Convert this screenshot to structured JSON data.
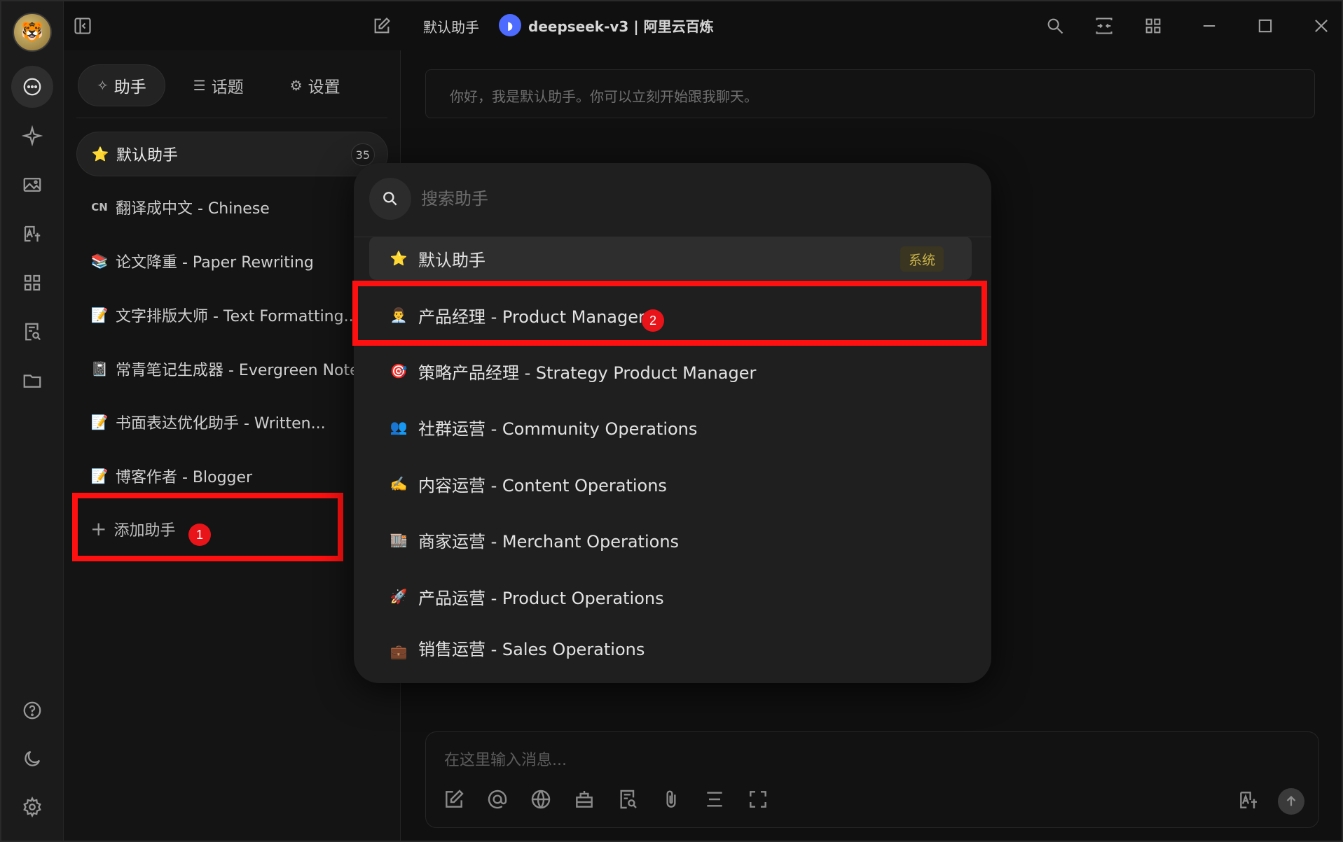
{
  "titlebar": {
    "assistant_title": "默认助手",
    "model_name": "deepseek-v3 | 阿里云百炼",
    "model_logo_icon": "deepseek-whale-icon"
  },
  "sidebar": {
    "tabs": [
      {
        "label": "助手",
        "icon": "sparkle-icon",
        "active": true
      },
      {
        "label": "话题",
        "icon": "list-icon",
        "active": false
      },
      {
        "label": "设置",
        "icon": "gear-icon",
        "active": false
      }
    ],
    "assistants": [
      {
        "emoji": "⭐",
        "label": "默认助手",
        "count": "35",
        "active": true
      },
      {
        "emoji": "CN",
        "label": "翻译成中文 - Chinese"
      },
      {
        "emoji": "📚",
        "label": "论文降重 - Paper Rewriting"
      },
      {
        "emoji": "📝",
        "label": "文字排版大师 - Text Formatting..."
      },
      {
        "emoji": "📓",
        "label": "常青笔记生成器 - Evergreen Note..."
      },
      {
        "emoji": "📝",
        "label": "书面表达优化助手 - Written..."
      },
      {
        "emoji": "📝",
        "label": "博客作者 - Blogger"
      }
    ],
    "add_label": "添加助手"
  },
  "steps": {
    "one": "1",
    "two": "2"
  },
  "main": {
    "welcome": "你好，我是默认助手。你可以立刻开始跟我聊天。",
    "input_placeholder": "在这里输入消息..."
  },
  "popup": {
    "search_placeholder": "搜索助手",
    "items": [
      {
        "emoji": "⭐",
        "label": "默认助手",
        "tag": "系统",
        "active": true
      },
      {
        "emoji": "👨‍💼",
        "label": "产品经理 - Product Manager"
      },
      {
        "emoji": "🎯",
        "label": "策略产品经理 - Strategy Product Manager"
      },
      {
        "emoji": "👥",
        "label": "社群运营 - Community Operations"
      },
      {
        "emoji": "✍️",
        "label": "内容运营 - Content Operations"
      },
      {
        "emoji": "🏬",
        "label": "商家运营 - Merchant Operations"
      },
      {
        "emoji": "🚀",
        "label": "产品运营 - Product Operations"
      },
      {
        "emoji": "💼",
        "label": "销售运营 - Sales Operations"
      }
    ]
  },
  "colors": {
    "highlight_red": "#ff1010",
    "system_tag": "#c8b24a",
    "model_logo": "#4d6bfe"
  }
}
